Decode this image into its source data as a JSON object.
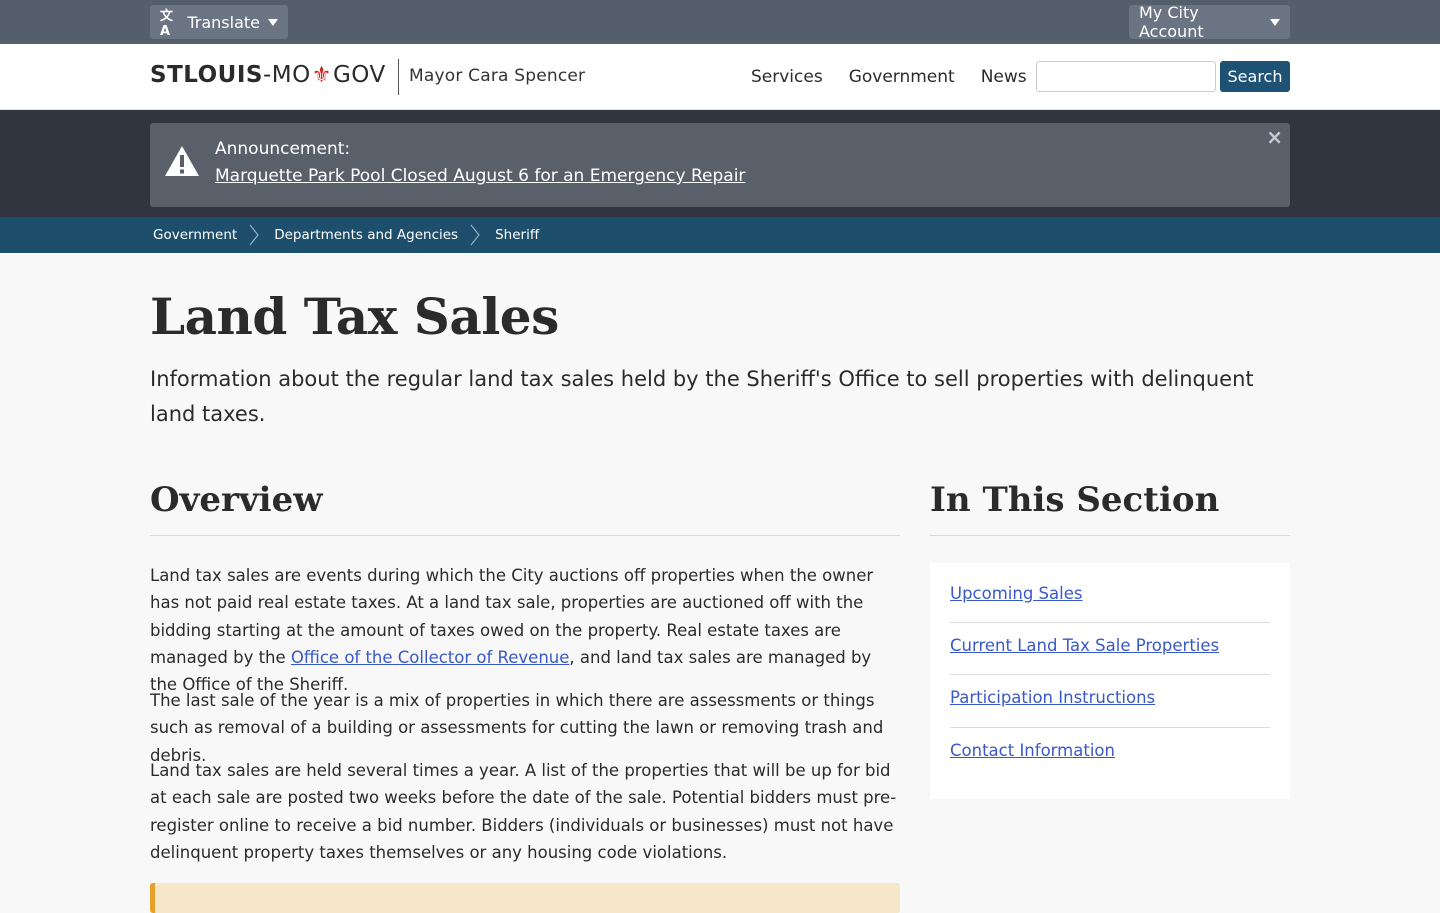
{
  "utility_bar": {
    "translate_label": "Translate",
    "account_label": "My City Account"
  },
  "header": {
    "logo_bold": "STLOUIS",
    "logo_mid": "-MO",
    "logo_end": "GOV",
    "mayor": "Mayor Cara Spencer",
    "nav": [
      "Services",
      "Government",
      "News"
    ],
    "search_placeholder": "",
    "search_button": "Search"
  },
  "announcement": {
    "title": "Announcement:",
    "link": "Marquette Park Pool Closed August 6 for an Emergency Repair",
    "close": "×"
  },
  "breadcrumb": [
    "Government",
    "Departments and Agencies",
    "Sheriff"
  ],
  "page": {
    "title": "Land Tax Sales",
    "lede": "Information about the regular land tax sales held by the Sheriff's Office to sell properties with delinquent land taxes."
  },
  "overview": {
    "heading": "Overview",
    "p1_before": "Land tax sales are events during which the City auctions off properties when the owner has not paid real estate taxes. At a land tax sale, properties are auctioned off with the bidding starting at the amount of taxes owed on the property. Real estate taxes are managed by the ",
    "p1_link": "Office of the Collector of Revenue",
    "p1_after": ", and land tax sales are managed by the Office of the Sheriff.",
    "p2": "The last sale of the year is a mix of properties in which there are assessments or things such as removal of a building or assessments for cutting the lawn or removing trash and debris.",
    "p3": "Land tax sales are held several times a year. A list of the properties that will be up for bid at each sale are posted two weeks before the date of the sale. Potential bidders must pre-register online to receive a bid number. Bidders (individuals or businesses) must not have delinquent property taxes themselves or any housing code violations."
  },
  "section": {
    "heading": "In This Section",
    "links": [
      "Upcoming Sales",
      "Current Land Tax Sale Properties",
      "Participation Instructions",
      "Contact Information"
    ]
  },
  "colors": {
    "util_bar": "#555e6b",
    "alert_band": "#2f3640",
    "breadcrumb": "#1d4f6c",
    "search_button": "#1e5275",
    "link": "#3a59c8",
    "callout": "#f5e7c8",
    "callout_border": "#e8a02c"
  }
}
